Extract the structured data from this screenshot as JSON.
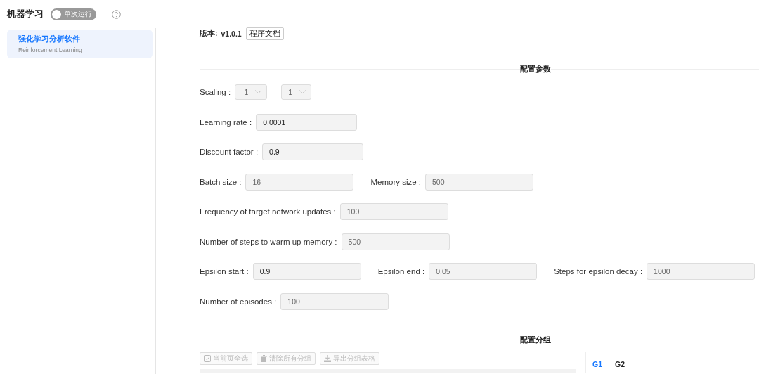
{
  "header": {
    "title": "机器学习",
    "toggle": {
      "label": "单次运行",
      "on": false,
      "disabled": true
    }
  },
  "sidebar": {
    "items": [
      {
        "title": "强化学习分析软件",
        "subtitle": "Reinforcement Learning",
        "selected": true
      }
    ]
  },
  "version": {
    "label": "版本:",
    "value": "v1.0.1",
    "button": "程序文档"
  },
  "config_section": {
    "title": "配置参数"
  },
  "rows": [
    [
      {
        "kind": "select",
        "label": "Scaling :",
        "value": "-1",
        "disabled": true
      },
      {
        "kind": "separator",
        "text": "-"
      },
      {
        "kind": "select",
        "value": "1",
        "disabled": true
      }
    ],
    [
      {
        "kind": "input",
        "label": "Learning rate :",
        "value": "0.0001",
        "disabled": false
      }
    ],
    [
      {
        "kind": "input",
        "label": "Discount factor :",
        "value": "0.9",
        "disabled": false
      }
    ],
    [
      {
        "kind": "input",
        "label": "Batch size :",
        "value": "16",
        "disabled": true
      },
      {
        "kind": "input",
        "label": "Memory size :",
        "value": "500",
        "disabled": true
      }
    ],
    [
      {
        "kind": "input",
        "label": "Frequency of target network updates :",
        "value": "100",
        "disabled": true
      }
    ],
    [
      {
        "kind": "input",
        "label": "Number of steps to warm up memory :",
        "value": "500",
        "disabled": true
      }
    ],
    [
      {
        "kind": "input",
        "label": "Epsilon start :",
        "value": "0.9",
        "disabled": false
      },
      {
        "kind": "input",
        "label": "Epsilon end :",
        "value": "0.05",
        "disabled": true
      },
      {
        "kind": "input",
        "label": "Steps for epsilon decay :",
        "value": "1000",
        "disabled": true
      }
    ],
    [
      {
        "kind": "input",
        "label": "Number of episodes :",
        "value": "100",
        "disabled": true
      }
    ]
  ],
  "group_section": {
    "title": "配置分组",
    "buttons": [
      {
        "label": "当前页全选",
        "disabled": true
      },
      {
        "label": "清除所有分组",
        "disabled": true
      },
      {
        "label": "导出分组表格",
        "disabled": true
      }
    ],
    "tabs": [
      {
        "label": "G1",
        "selected": true
      },
      {
        "label": "G2",
        "selected": false
      }
    ]
  }
}
